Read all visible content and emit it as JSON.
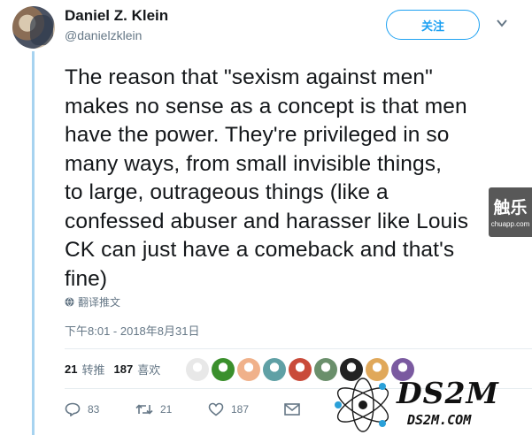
{
  "author": {
    "name": "Daniel Z. Klein",
    "handle": "@danielzklein"
  },
  "follow_button": {
    "label": "关注"
  },
  "tweet": {
    "text": "The reason that \"sexism against men\"\nmakes no sense as a concept is that men\nhave the power. They're privileged in so\nmany ways, from small invisible things,\nto large, outrageous things (like a\nconfessed abuser and harasser like Louis\nCK can just have a comeback and that's\nfine)",
    "translate_label": "翻译推文",
    "timestamp": "下午8:01 - 2018年8月31日"
  },
  "stats": {
    "retweets_count": "21",
    "retweets_label": "转推",
    "likes_count": "187",
    "likes_label": "喜欢"
  },
  "actions": {
    "reply_count": "83",
    "retweet_count": "21",
    "like_count": "187"
  },
  "likers": [
    {
      "color": "#e8e8e8"
    },
    {
      "color": "#3a8f2c"
    },
    {
      "color": "#f0b18a"
    },
    {
      "color": "#5fa0a5"
    },
    {
      "color": "#c94b3a"
    },
    {
      "color": "#6a8f6b"
    },
    {
      "color": "#222222"
    },
    {
      "color": "#e0a85a"
    },
    {
      "color": "#7a5aa0"
    }
  ],
  "watermarks": {
    "chuapp_big": "触乐",
    "chuapp_small": "chuapp.com",
    "ds2m_main": "DS2M",
    "ds2m_sub": "DS2M.COM"
  },
  "colors": {
    "accent": "#1da1f2",
    "secondary_text": "#657786",
    "thread_line": "#a7d3f0"
  }
}
